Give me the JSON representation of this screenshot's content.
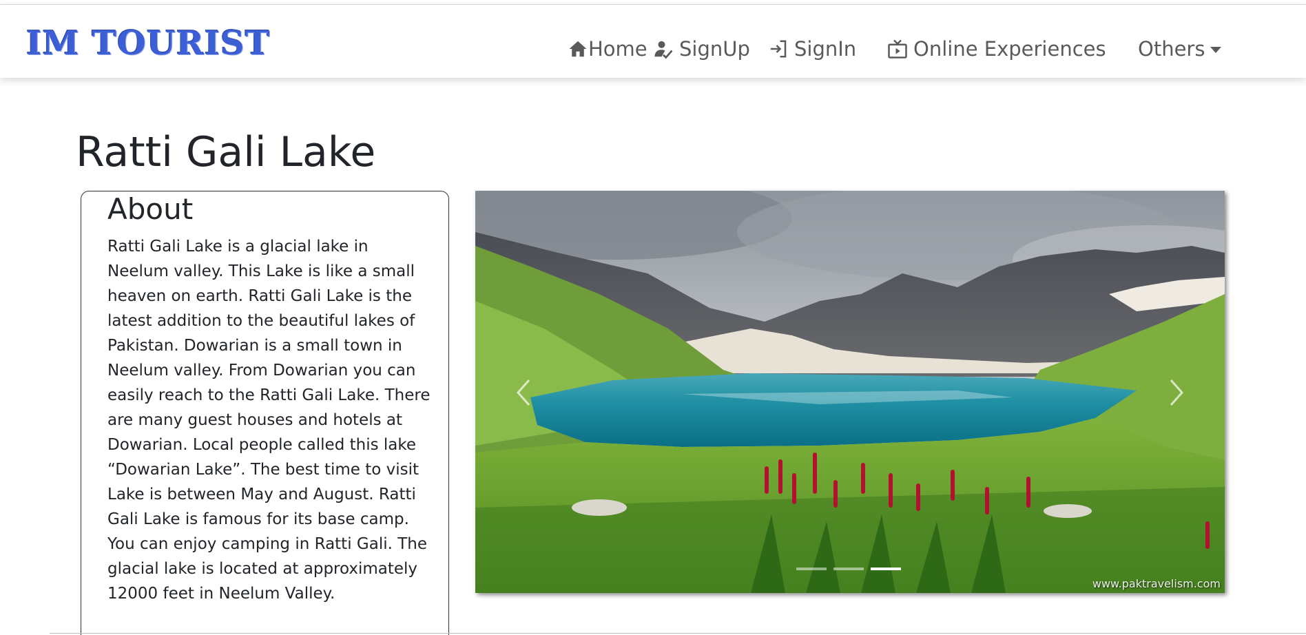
{
  "brand": {
    "logo_text": "IM TOURIST",
    "logo_color": "#3d5fd6"
  },
  "nav": {
    "items": [
      {
        "label": "Home",
        "icon": "home-icon"
      },
      {
        "label": "SignUp",
        "icon": "user-check-icon"
      },
      {
        "label": "SignIn",
        "icon": "sign-in-icon"
      },
      {
        "label": "Online Experiences",
        "icon": "tv-icon"
      },
      {
        "label": "Others",
        "icon": "caret-down-icon"
      }
    ]
  },
  "page": {
    "title": "Ratti Gali Lake"
  },
  "about": {
    "heading": "About",
    "text": "Ratti Gali Lake is a glacial lake in Neelum valley. This Lake is like a small heaven on earth. Ratti Gali Lake is the latest addition to the beautiful lakes of Pakistan. Dowarian is a small town in Neelum valley. From Dowarian you can easily reach to the Ratti Gali Lake. There are many guest houses and hotels at Dowarian. Local people called this lake “Dowarian Lake”. The best time to visit Lake is between May and August. Ratti Gali Lake is famous for its base camp. You can enjoy camping in Ratti Gali. The glacial lake is located at approximately 12000 feet in Neelum Valley."
  },
  "carousel": {
    "watermark": "www.paktravelism.com",
    "slide_count": 3,
    "active_index": 2,
    "prev_icon": "chevron-left-icon",
    "next_icon": "chevron-right-icon"
  }
}
